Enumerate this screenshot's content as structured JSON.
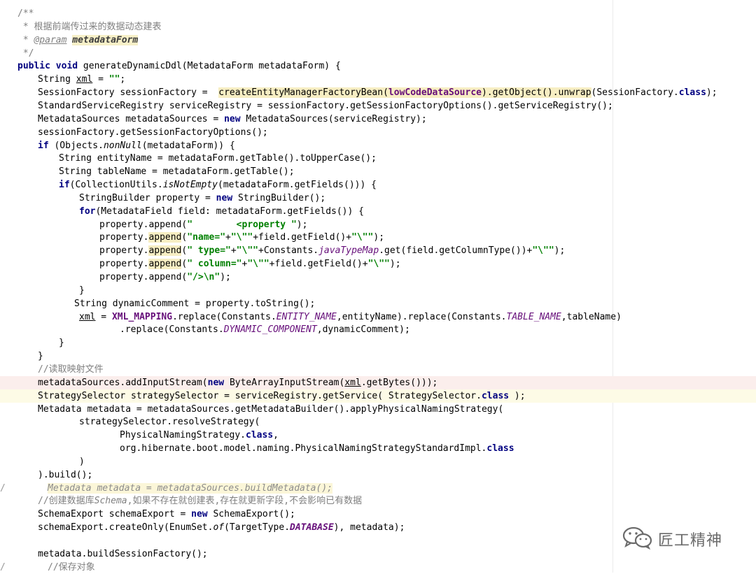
{
  "editor": {
    "lines": [
      {
        "indent": 25,
        "hl": "",
        "segs": [
          [
            "cmt",
            "/**"
          ]
        ]
      },
      {
        "indent": 25,
        "hl": "",
        "segs": [
          [
            "cmt",
            " * 根据前端传过来的数据动态建表"
          ]
        ]
      },
      {
        "indent": 25,
        "hl": "",
        "segs": [
          [
            "cmt",
            " * "
          ],
          [
            "tag",
            "@param"
          ],
          [
            "plain",
            " "
          ],
          [
            "param",
            "metadataForm"
          ]
        ]
      },
      {
        "indent": 25,
        "hl": "",
        "segs": [
          [
            "cmt",
            " */"
          ]
        ]
      },
      {
        "indent": 25,
        "hl": "",
        "segs": [
          [
            "kw",
            "public void "
          ],
          [
            "plain",
            "generateDynamicDdl(MetadataForm metadataForm) {"
          ]
        ]
      },
      {
        "indent": 54,
        "hl": "",
        "segs": [
          [
            "plain",
            "String "
          ],
          [
            "u",
            "xml"
          ],
          [
            "plain",
            " = "
          ],
          [
            "str",
            "\"\""
          ],
          [
            "plain",
            ";"
          ]
        ]
      },
      {
        "indent": 54,
        "hl": "",
        "segs": [
          [
            "plain",
            "SessionFactory sessionFactory =  "
          ],
          [
            "hlw",
            "createEntityManagerFactoryBean("
          ],
          [
            "hlwb",
            "lowCodeDataSource"
          ],
          [
            "hlw",
            ").getObject().unwrap"
          ],
          [
            "plain",
            "(SessionFactory."
          ],
          [
            "kw",
            "class"
          ],
          [
            "plain",
            ");"
          ]
        ]
      },
      {
        "indent": 54,
        "hl": "",
        "segs": [
          [
            "plain",
            "StandardServiceRegistry serviceRegistry = sessionFactory.getSessionFactoryOptions().getServiceRegistry();"
          ]
        ]
      },
      {
        "indent": 54,
        "hl": "",
        "segs": [
          [
            "plain",
            "MetadataSources metadataSources = "
          ],
          [
            "kw",
            "new "
          ],
          [
            "plain",
            "MetadataSources(serviceRegistry);"
          ]
        ]
      },
      {
        "indent": 54,
        "hl": "",
        "segs": [
          [
            "plain",
            "sessionFactory.getSessionFactoryOptions();"
          ]
        ]
      },
      {
        "indent": 54,
        "hl": "",
        "segs": [
          [
            "kw",
            "if "
          ],
          [
            "plain",
            "(Objects."
          ],
          [
            "it",
            "nonNull"
          ],
          [
            "plain",
            "(metadataForm)) {"
          ]
        ]
      },
      {
        "indent": 84,
        "hl": "",
        "segs": [
          [
            "plain",
            "String entityName = metadataForm.getTable().toUpperCase();"
          ]
        ]
      },
      {
        "indent": 84,
        "hl": "",
        "segs": [
          [
            "plain",
            "String tableName = metadataForm.getTable();"
          ]
        ]
      },
      {
        "indent": 84,
        "hl": "",
        "segs": [
          [
            "kw",
            "if"
          ],
          [
            "plain",
            "(CollectionUtils."
          ],
          [
            "it",
            "isNotEmpty"
          ],
          [
            "plain",
            "(metadataForm.getFields())) {"
          ]
        ]
      },
      {
        "indent": 113,
        "hl": "",
        "segs": [
          [
            "plain",
            "StringBuilder property = "
          ],
          [
            "kw",
            "new "
          ],
          [
            "plain",
            "StringBuilder();"
          ]
        ]
      },
      {
        "indent": 113,
        "hl": "",
        "segs": [
          [
            "kw",
            "for"
          ],
          [
            "plain",
            "(MetadataField field: metadataForm.getFields()) {"
          ]
        ]
      },
      {
        "indent": 142,
        "hl": "",
        "segs": [
          [
            "plain",
            "property.append("
          ],
          [
            "str",
            "\"        <property \""
          ],
          [
            "plain",
            ");"
          ]
        ]
      },
      {
        "indent": 142,
        "hl": "",
        "segs": [
          [
            "plain",
            "property."
          ],
          [
            "hlw",
            "append"
          ],
          [
            "plain",
            "("
          ],
          [
            "str",
            "\"name=\""
          ],
          [
            "plain",
            "+"
          ],
          [
            "str",
            "\"\\\"\""
          ],
          [
            "plain",
            "+field.getField()+"
          ],
          [
            "str",
            "\"\\\"\""
          ],
          [
            "plain",
            ");"
          ]
        ]
      },
      {
        "indent": 142,
        "hl": "",
        "segs": [
          [
            "plain",
            "property."
          ],
          [
            "hlw",
            "append"
          ],
          [
            "plain",
            "("
          ],
          [
            "str",
            "\" type=\""
          ],
          [
            "plain",
            "+"
          ],
          [
            "str",
            "\"\\\"\""
          ],
          [
            "plain",
            "+Constants."
          ],
          [
            "const",
            "javaTypeMap"
          ],
          [
            "plain",
            ".get(field.getColumnType())+"
          ],
          [
            "str",
            "\"\\\"\""
          ],
          [
            "plain",
            ");"
          ]
        ]
      },
      {
        "indent": 142,
        "hl": "",
        "segs": [
          [
            "plain",
            "property."
          ],
          [
            "hlw",
            "append"
          ],
          [
            "plain",
            "("
          ],
          [
            "str",
            "\" column=\""
          ],
          [
            "plain",
            "+"
          ],
          [
            "str",
            "\"\\\"\""
          ],
          [
            "plain",
            "+field.getField()+"
          ],
          [
            "str",
            "\"\\\"\""
          ],
          [
            "plain",
            ");"
          ]
        ]
      },
      {
        "indent": 142,
        "hl": "",
        "segs": [
          [
            "plain",
            "property.append("
          ],
          [
            "str",
            "\"/>\\n\""
          ],
          [
            "plain",
            ");"
          ]
        ]
      },
      {
        "indent": 113,
        "hl": "",
        "segs": [
          [
            "plain",
            "}"
          ]
        ]
      },
      {
        "indent": 106,
        "hl": "",
        "segs": [
          [
            "plain",
            "String dynamicComment = property.toString();"
          ]
        ]
      },
      {
        "indent": 113,
        "hl": "",
        "segs": [
          [
            "u",
            "xml"
          ],
          [
            "plain",
            " = "
          ],
          [
            "field",
            "XML_MAPPING"
          ],
          [
            "plain",
            ".replace(Constants."
          ],
          [
            "const",
            "ENTITY_NAME"
          ],
          [
            "plain",
            ",entityName).replace(Constants."
          ],
          [
            "const",
            "TABLE_NAME"
          ],
          [
            "plain",
            ",tableName)"
          ]
        ]
      },
      {
        "indent": 171,
        "hl": "",
        "segs": [
          [
            "plain",
            ".replace(Constants."
          ],
          [
            "const",
            "DYNAMIC_COMPONENT"
          ],
          [
            "plain",
            ",dynamicComment);"
          ]
        ]
      },
      {
        "indent": 84,
        "hl": "",
        "segs": [
          [
            "plain",
            "}"
          ]
        ]
      },
      {
        "indent": 54,
        "hl": "",
        "segs": [
          [
            "plain",
            "}"
          ]
        ]
      },
      {
        "indent": 54,
        "hl": "",
        "segs": [
          [
            "cmt",
            "//读取映射文件"
          ]
        ]
      },
      {
        "indent": 54,
        "hl": "red",
        "segs": [
          [
            "plain",
            "metadataSources.addInputStream("
          ],
          [
            "kw",
            "new "
          ],
          [
            "plain",
            "ByteArrayInputStream("
          ],
          [
            "u",
            "xml"
          ],
          [
            "plain",
            ".getBytes()));"
          ]
        ]
      },
      {
        "indent": 54,
        "hl": "yellow",
        "segs": [
          [
            "plain",
            "StrategySelector strategySelector = serviceRegistry.getService( StrategySelector."
          ],
          [
            "kw",
            "class"
          ],
          [
            "plain",
            " );"
          ]
        ]
      },
      {
        "indent": 54,
        "hl": "",
        "segs": [
          [
            "plain",
            "Metadata metadata = metadataSources.getMetadataBuilder().applyPhysicalNamingStrategy("
          ]
        ]
      },
      {
        "indent": 113,
        "hl": "",
        "segs": [
          [
            "plain",
            "strategySelector.resolveStrategy("
          ]
        ]
      },
      {
        "indent": 171,
        "hl": "",
        "segs": [
          [
            "plain",
            "PhysicalNamingStrategy."
          ],
          [
            "kw",
            "class"
          ],
          [
            "plain",
            ","
          ]
        ]
      },
      {
        "indent": 171,
        "hl": "",
        "segs": [
          [
            "plain",
            "org.hibernate.boot.model.naming.PhysicalNamingStrategyStandardImpl."
          ],
          [
            "kw",
            "class"
          ]
        ]
      },
      {
        "indent": 113,
        "hl": "",
        "segs": [
          [
            "plain",
            ")"
          ]
        ]
      },
      {
        "indent": 54,
        "hl": "",
        "segs": [
          [
            "plain",
            ").build();"
          ]
        ]
      },
      {
        "indent": 68,
        "hl": "",
        "gutter": "/",
        "segs": [
          [
            "inactive",
            "Metadata metadata = metadataSources.buildMetadata();"
          ]
        ]
      },
      {
        "indent": 54,
        "hl": "",
        "segs": [
          [
            "cmt",
            "//创建数据库"
          ],
          [
            "cmt-it",
            "Schema"
          ],
          [
            "cmt",
            ",如果不存在就创建表,存在就更新字段,不会影响已有数据"
          ]
        ]
      },
      {
        "indent": 54,
        "hl": "",
        "segs": [
          [
            "plain",
            "SchemaExport schemaExport = "
          ],
          [
            "kw",
            "new "
          ],
          [
            "plain",
            "SchemaExport();"
          ]
        ]
      },
      {
        "indent": 54,
        "hl": "",
        "segs": [
          [
            "plain",
            "schemaExport.createOnly(EnumSet."
          ],
          [
            "it",
            "of"
          ],
          [
            "plain",
            "(TargetType."
          ],
          [
            "field-it",
            "DATABASE"
          ],
          [
            "plain",
            "), metadata);"
          ]
        ]
      },
      {
        "indent": 54,
        "hl": "",
        "segs": [
          [
            "plain",
            ""
          ]
        ]
      },
      {
        "indent": 54,
        "hl": "",
        "segs": [
          [
            "plain",
            "metadata.buildSessionFactory();"
          ]
        ]
      },
      {
        "indent": 68,
        "hl": "",
        "gutter": "/",
        "segs": [
          [
            "cmt",
            "//保存对象"
          ]
        ]
      }
    ]
  },
  "watermark": {
    "text": "匠工精神",
    "icon": "wechat-icon"
  },
  "colors": {
    "keyword": "#000080",
    "string": "#008000",
    "comment": "#808080",
    "constant": "#660e7a",
    "highlight_red": "#fbeeec",
    "highlight_yellow": "#fdfbe6"
  }
}
